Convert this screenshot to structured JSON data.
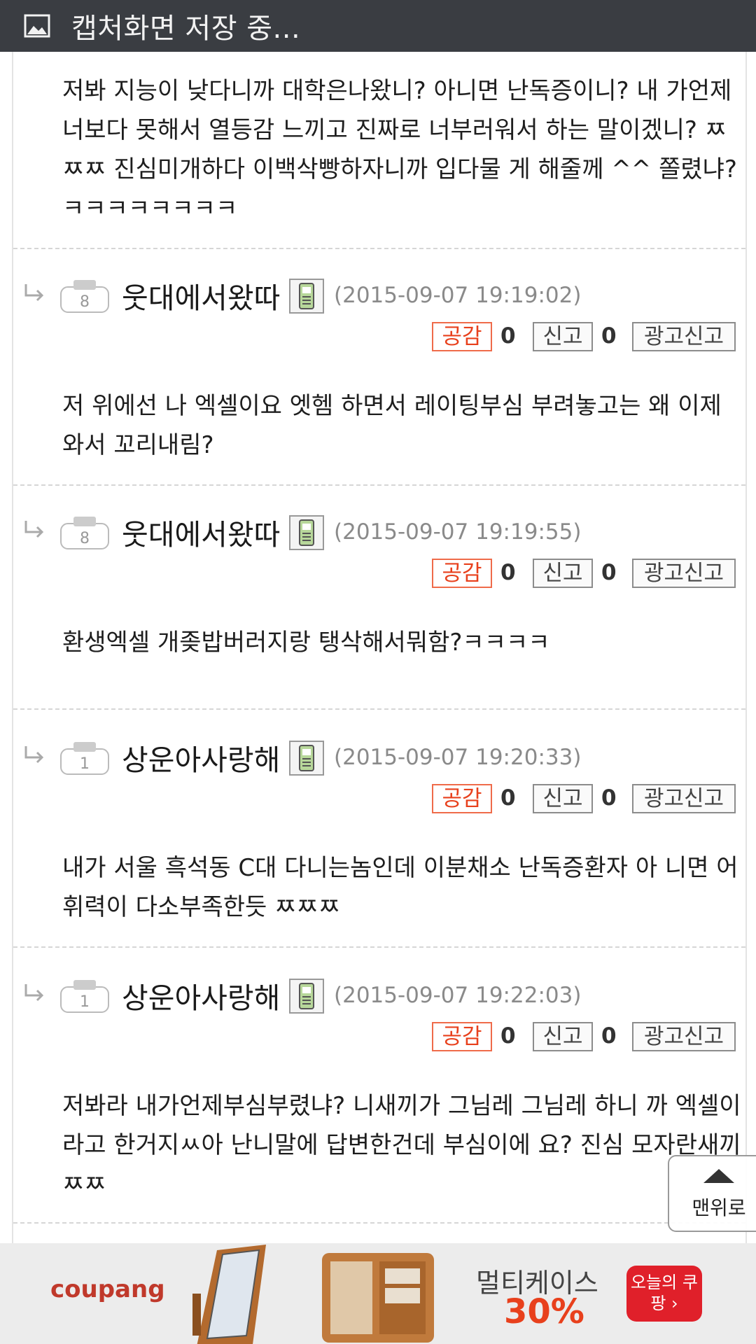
{
  "status_bar": {
    "icon": "image-icon",
    "title": "캡처화면 저장 중..."
  },
  "first_comment_text": "저봐 지능이 낮다니까 대학은나왔니? 아니면 난독증이니? 내 가언제 너보다 못해서 열등감 느끼고 진짜로 너부러워서 하는 말이겠니? ㅉㅉㅉ 진심미개하다 이백삭빵하자니까 입다물 게 해줄께 ^^ 쫄렸냐? ㅋㅋㅋㅋㅋㅋㅋㅋ",
  "buttons": {
    "like": "공감",
    "report": "신고",
    "ad_report": "광고신고"
  },
  "replies": [
    {
      "level": "8",
      "author": "웃대에서왔따",
      "timestamp": "(2015-09-07 19:19:02)",
      "like_count": "0",
      "report_count": "0",
      "text": "저 위에선 나 엑셀이요 엣헴 하면서 레이팅부심 부려놓고는 왜 이제와서 꼬리내림?"
    },
    {
      "level": "8",
      "author": "웃대에서왔따",
      "timestamp": "(2015-09-07 19:19:55)",
      "like_count": "0",
      "report_count": "0",
      "text": "환생엑셀 개좆밥버러지랑 탱삭해서뭐함?ㅋㅋㅋㅋ"
    },
    {
      "level": "1",
      "author": "상운아사랑해",
      "timestamp": "(2015-09-07 19:20:33)",
      "like_count": "0",
      "report_count": "0",
      "text": "내가 서울 흑석동 C대 다니는놈인데 이분채소 난독증환자 아 니면 어휘력이 다소부족한듯 ㅉㅉㅉ"
    },
    {
      "level": "1",
      "author": "상운아사랑해",
      "timestamp": "(2015-09-07 19:22:03)",
      "like_count": "0",
      "report_count": "0",
      "text": "저봐라 내가언제부심부렸냐? 니새끼가 그님레 그님레 하니 까 엑셀이라고 한거지ㅆ아 난니말에 답변한건데 부심이에 요? 진심 모자란새끼 ㅉㅉ"
    }
  ],
  "scroll_top": {
    "label": "맨위로"
  },
  "ad": {
    "brand": "coupang",
    "product": "멀티케이스",
    "discount": "30%",
    "cta": "오늘의 쿠팡 ›"
  },
  "colors": {
    "accent": "#e8401c",
    "status_bar": "#3a3d42"
  }
}
